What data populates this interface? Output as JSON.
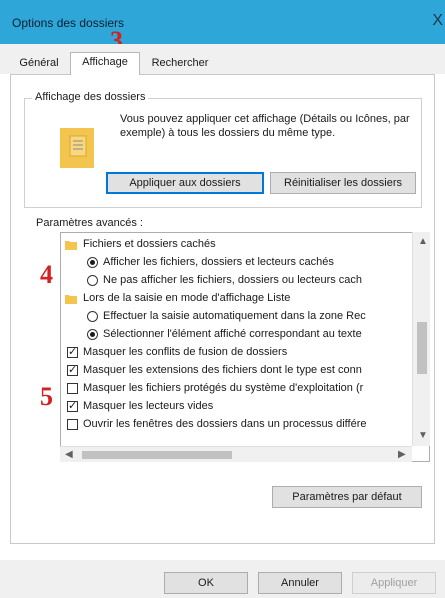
{
  "window": {
    "title": "Options des dossiers",
    "close_glyph": "X"
  },
  "annotations": {
    "tab_step": "3",
    "settings_step": "4",
    "checkbox_step": "5"
  },
  "tabs": [
    {
      "label": "Général",
      "active": false
    },
    {
      "label": "Affichage",
      "active": true
    },
    {
      "label": "Rechercher",
      "active": false
    }
  ],
  "folder_views": {
    "title": "Affichage des dossiers",
    "description": "Vous pouvez appliquer cet affichage (Détails ou Icônes, par exemple) à tous les dossiers du même type.",
    "apply_button": "Appliquer aux dossiers",
    "reset_button": "Réinitialiser les dossiers"
  },
  "advanced": {
    "label": "Paramètres avancés :",
    "items": [
      {
        "kind": "folder",
        "label": "Fichiers et dossiers cachés"
      },
      {
        "kind": "radio",
        "checked": true,
        "label": "Afficher les fichiers, dossiers et lecteurs cachés"
      },
      {
        "kind": "radio",
        "checked": false,
        "label": "Ne pas afficher les fichiers, dossiers ou lecteurs cach"
      },
      {
        "kind": "folder",
        "label": "Lors de la saisie en mode d'affichage Liste"
      },
      {
        "kind": "radio",
        "checked": false,
        "label": "Effectuer la saisie automatiquement dans la zone Rec"
      },
      {
        "kind": "radio",
        "checked": true,
        "label": "Sélectionner l'élément affiché correspondant au texte"
      },
      {
        "kind": "checkbox",
        "checked": true,
        "label": "Masquer les conflits de fusion de dossiers"
      },
      {
        "kind": "checkbox",
        "checked": true,
        "label": "Masquer les extensions des fichiers dont le type est conn"
      },
      {
        "kind": "checkbox",
        "checked": false,
        "label": "Masquer les fichiers protégés du système d'exploitation (r"
      },
      {
        "kind": "checkbox",
        "checked": true,
        "label": "Masquer les lecteurs vides"
      },
      {
        "kind": "checkbox",
        "checked": false,
        "label": "Ouvrir les fenêtres des dossiers dans un processus différe"
      }
    ]
  },
  "defaults_button": "Paramètres par défaut",
  "footer": {
    "ok": "OK",
    "cancel": "Annuler",
    "apply": "Appliquer"
  },
  "colors": {
    "titlebar": "#2ea6d8",
    "annotation": "#d42020",
    "focus": "#0078d7",
    "folder": "#f3c44e"
  }
}
